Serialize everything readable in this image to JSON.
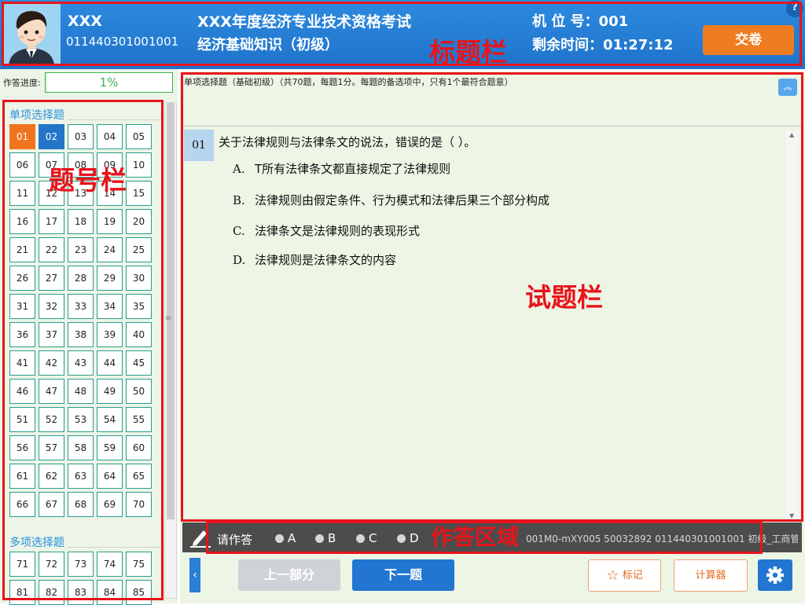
{
  "header": {
    "candidate_name": "XXX",
    "candidate_id": "011440301001001",
    "exam_title": "XXX年度经济专业技术资格考试",
    "subject": "经济基础知识（初级）",
    "seat_label": "机 位 号：",
    "seat_value": "001",
    "time_label": "剩余时间：",
    "time_value": "01:27:12",
    "submit_label": "交卷",
    "help_label": "?"
  },
  "annotations": {
    "title_bar": "标题栏",
    "number_bar": "题号栏",
    "question_bar": "试题栏",
    "answer_area": "作答区域"
  },
  "progress": {
    "label": "作答进度:",
    "text": "1%",
    "percent": 1
  },
  "sections": [
    {
      "title": "单项选择题",
      "numbers": [
        "01",
        "02",
        "03",
        "04",
        "05",
        "06",
        "07",
        "08",
        "09",
        "10",
        "11",
        "12",
        "13",
        "14",
        "15",
        "16",
        "17",
        "18",
        "19",
        "20",
        "21",
        "22",
        "23",
        "24",
        "25",
        "26",
        "27",
        "28",
        "29",
        "30",
        "31",
        "32",
        "33",
        "34",
        "35",
        "36",
        "37",
        "38",
        "39",
        "40",
        "41",
        "42",
        "43",
        "44",
        "45",
        "46",
        "47",
        "48",
        "49",
        "50",
        "51",
        "52",
        "53",
        "54",
        "55",
        "56",
        "57",
        "58",
        "59",
        "60",
        "61",
        "62",
        "63",
        "64",
        "65",
        "66",
        "67",
        "68",
        "69",
        "70"
      ]
    },
    {
      "title": "多项选择题",
      "numbers": [
        "71",
        "72",
        "73",
        "74",
        "75",
        "81",
        "82",
        "83",
        "84",
        "85"
      ]
    }
  ],
  "current_question": "01",
  "selected_question": "02",
  "question": {
    "section_desc": "单项选择题（基础初级）（共70题，每题1分。每题的备选项中，只有1个最符合题意）",
    "number": "01",
    "stem": "关于法律规则与法律条文的说法，错误的是（   ）。",
    "options": [
      {
        "letter": "A.",
        "text": "T所有法律条文都直接规定了法律规则"
      },
      {
        "letter": "B.",
        "text": "法律规则由假定条件、行为模式和法律后果三个部分构成"
      },
      {
        "letter": "C.",
        "text": "法律条文是法律规则的表现形式"
      },
      {
        "letter": "D.",
        "text": "法律规则是法律条文的内容"
      }
    ]
  },
  "answer_bar": {
    "prompt": "请作答",
    "choices": [
      "A",
      "B",
      "C",
      "D"
    ],
    "meta": "001M0-mXY005  50032892 011440301001001 初级_工商管..."
  },
  "nav": {
    "prev_label": "上一部分",
    "next_label": "下一题",
    "mark_label": "标记",
    "calc_label": "计算器"
  },
  "icons": {
    "mark": "star-icon",
    "settings": "gear-icon",
    "pen": "pen-icon",
    "collapse": "double-chevron-up-icon",
    "sidebar_toggle": "chevron-left-icon"
  },
  "colors": {
    "header_blue": "#2a84dc",
    "submit_orange": "#f07c22",
    "current_orange": "#f0741e",
    "selected_blue": "#2475c8",
    "annotation_red": "#e8141b",
    "panel_green": "#edf5e5"
  }
}
